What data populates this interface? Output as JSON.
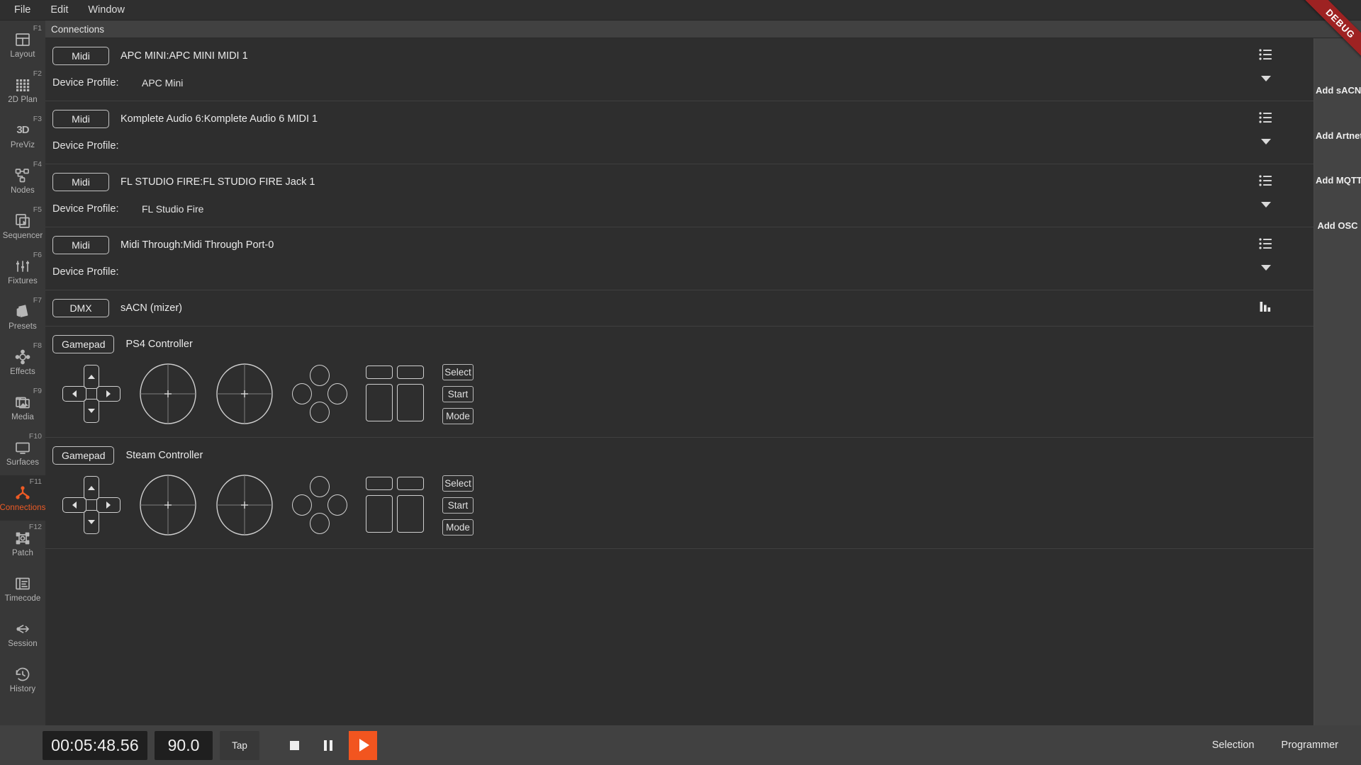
{
  "menubar": {
    "items": [
      {
        "label": "File"
      },
      {
        "label": "Edit"
      },
      {
        "label": "Window"
      }
    ]
  },
  "debug_ribbon": {
    "label": "DEBUG"
  },
  "sidebar": {
    "items": [
      {
        "label": "Layout",
        "fkey": "F1",
        "icon": "layout-icon"
      },
      {
        "label": "2D Plan",
        "fkey": "F2",
        "icon": "grid-icon"
      },
      {
        "label": "PreViz",
        "fkey": "F3",
        "icon": "three-d-icon"
      },
      {
        "label": "Nodes",
        "fkey": "F4",
        "icon": "nodes-icon"
      },
      {
        "label": "Sequencer",
        "fkey": "F5",
        "icon": "sequencer-icon"
      },
      {
        "label": "Fixtures",
        "fkey": "F6",
        "icon": "faders-icon"
      },
      {
        "label": "Presets",
        "fkey": "F7",
        "icon": "presets-icon"
      },
      {
        "label": "Effects",
        "fkey": "F8",
        "icon": "effects-icon"
      },
      {
        "label": "Media",
        "fkey": "F9",
        "icon": "media-icon"
      },
      {
        "label": "Surfaces",
        "fkey": "F10",
        "icon": "surfaces-icon"
      },
      {
        "label": "Connections",
        "fkey": "F11",
        "icon": "connections-icon"
      },
      {
        "label": "Patch",
        "fkey": "F12",
        "icon": "patch-icon"
      },
      {
        "label": "Timecode",
        "fkey": "",
        "icon": "timecode-icon"
      },
      {
        "label": "Session",
        "fkey": "",
        "icon": "session-icon"
      },
      {
        "label": "History",
        "fkey": "",
        "icon": "history-icon"
      }
    ]
  },
  "panel": {
    "title": "Connections"
  },
  "connections": [
    {
      "type": "Midi",
      "name": "APC MINI:APC MINI MIDI 1",
      "profile_label": "Device Profile:",
      "profile_value": "APC Mini",
      "has_profile": true,
      "right_icon": "list-icon"
    },
    {
      "type": "Midi",
      "name": "Komplete Audio 6:Komplete Audio 6 MIDI 1",
      "profile_label": "Device Profile:",
      "profile_value": "",
      "has_profile": true,
      "right_icon": "list-icon"
    },
    {
      "type": "Midi",
      "name": "FL STUDIO FIRE:FL STUDIO FIRE Jack 1",
      "profile_label": "Device Profile:",
      "profile_value": "FL Studio Fire",
      "has_profile": true,
      "right_icon": "list-icon"
    },
    {
      "type": "Midi",
      "name": "Midi Through:Midi Through Port-0",
      "profile_label": "Device Profile:",
      "profile_value": "",
      "has_profile": true,
      "right_icon": "list-icon"
    },
    {
      "type": "DMX",
      "name": "sACN (mizer)",
      "profile_label": "",
      "profile_value": "",
      "has_profile": false,
      "right_icon": "bar-chart-icon"
    },
    {
      "type": "Gamepad",
      "name": "PS4 Controller",
      "profile_label": "",
      "profile_value": "",
      "has_profile": false,
      "right_icon": ""
    },
    {
      "type": "Gamepad",
      "name": "Steam Controller",
      "profile_label": "",
      "profile_value": "",
      "has_profile": false,
      "right_icon": ""
    }
  ],
  "gamepad_buttons": {
    "select": "Select",
    "start": "Start",
    "mode": "Mode"
  },
  "add_panel": {
    "buttons": [
      {
        "label": "Add sACN"
      },
      {
        "label": "Add Artnet"
      },
      {
        "label": "Add MQTT"
      },
      {
        "label": "Add OSC"
      }
    ]
  },
  "transport": {
    "timecode": "00:05:48.56",
    "bpm": "90.0",
    "tap_label": "Tap",
    "stop_icon": "stop-icon",
    "pause_icon": "pause-icon",
    "play_icon": "play-icon",
    "selection_label": "Selection",
    "programmer_label": "Programmer"
  },
  "colors": {
    "accent": "#ef5b25",
    "play": "#f2551f",
    "panel_header": "#414141",
    "rail": "#383838",
    "content": "#2e2e2e",
    "debug": "#9e2222"
  }
}
